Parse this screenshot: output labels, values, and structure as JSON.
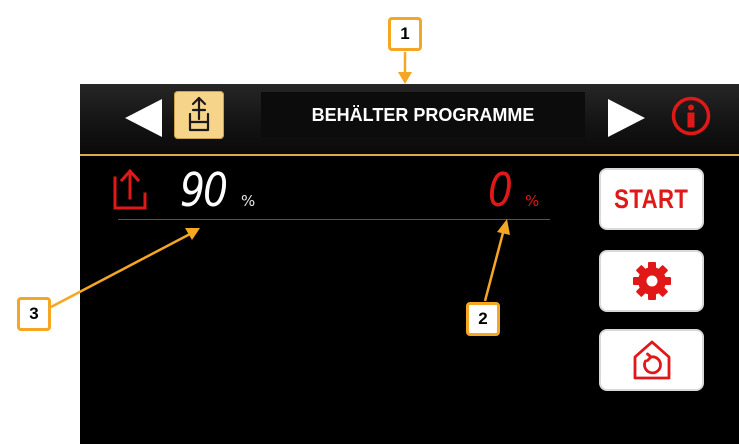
{
  "header": {
    "title": "BEHÄLTER PROGRAMME",
    "nav_left_icon": "triangle-left-icon",
    "nav_right_icon": "triangle-right-icon",
    "mode_icon": "container-lift-icon",
    "info_icon": "info-icon"
  },
  "status": {
    "current_value": "90",
    "current_unit": "%",
    "target_value": "0",
    "target_unit": "%",
    "unload_icon": "unload-arrow-icon"
  },
  "side_buttons": {
    "start_label": "START",
    "settings_icon": "gear-icon",
    "home_icon": "home-return-icon"
  },
  "callouts": [
    "1",
    "2",
    "3"
  ],
  "colors": {
    "accent_red": "#e01818",
    "callout_orange": "#f5a623",
    "mode_button_yellow": "#f6d58a",
    "header_separator": "#e3a74a",
    "screen_background": "#000000"
  }
}
